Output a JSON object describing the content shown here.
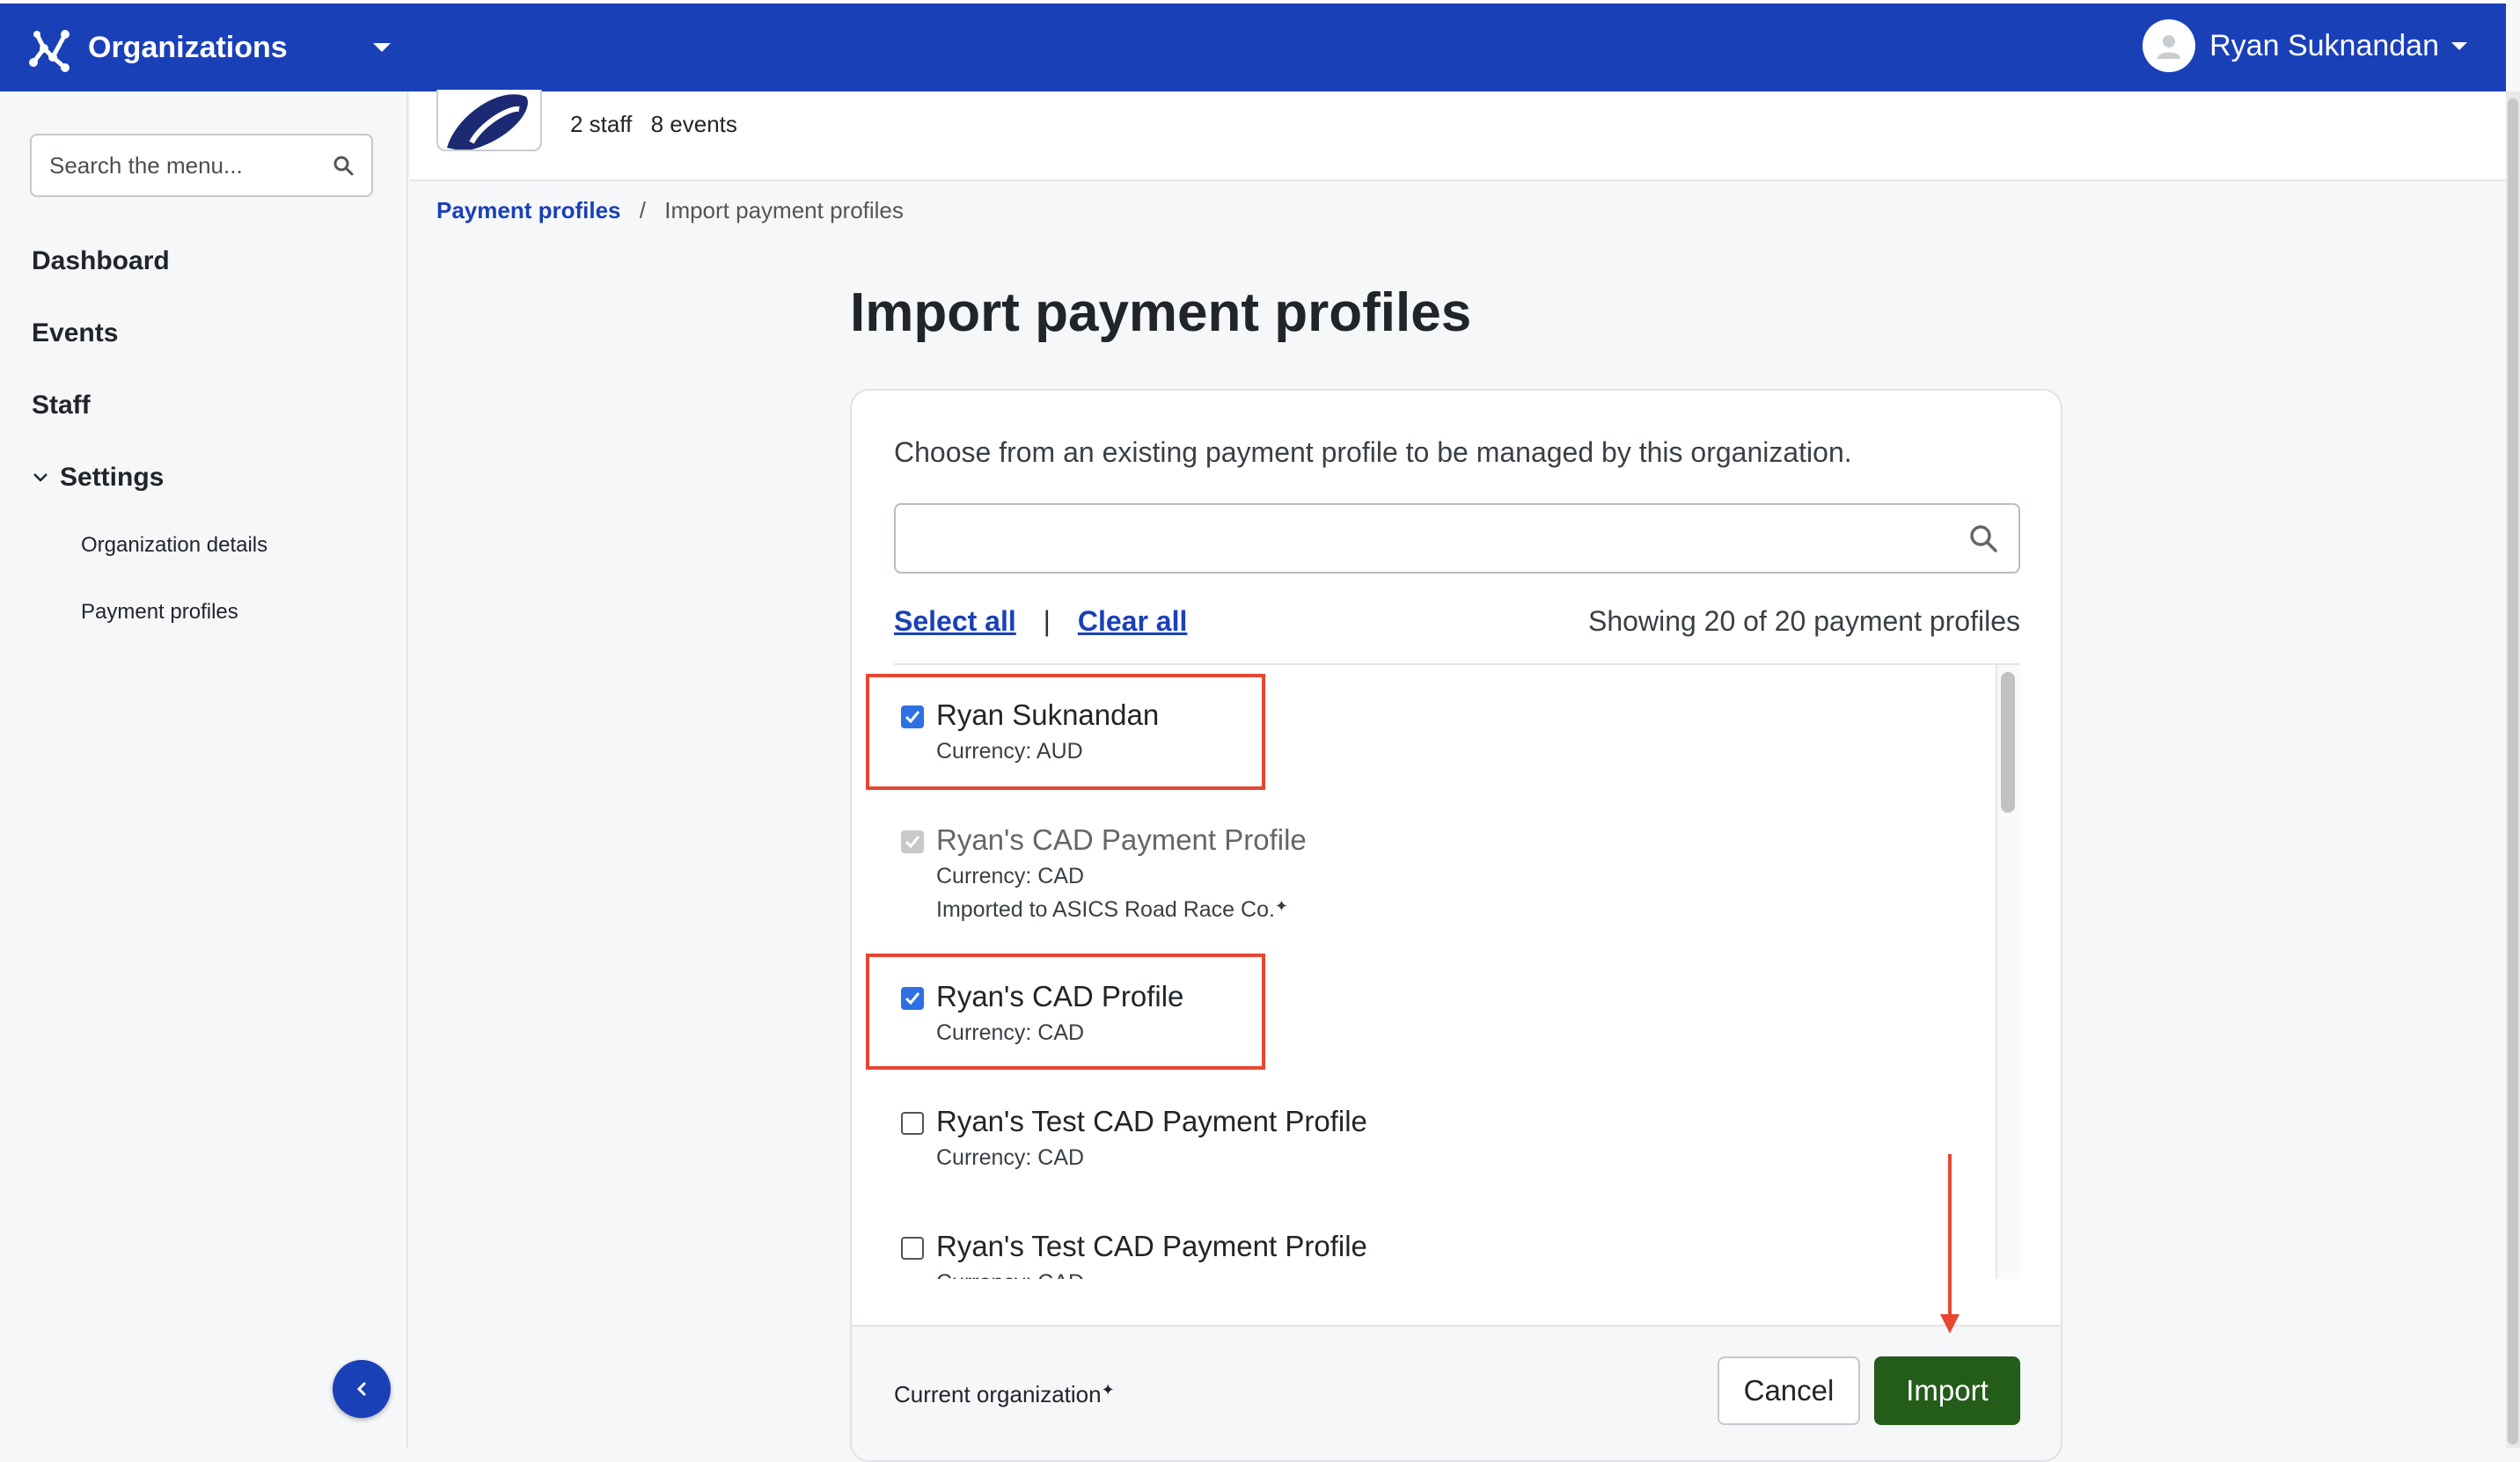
{
  "header": {
    "brand_label": "Organizations",
    "user_name": "Ryan Suknandan"
  },
  "sidebar": {
    "search_placeholder": "Search the menu...",
    "items": [
      {
        "label": "Dashboard"
      },
      {
        "label": "Events"
      },
      {
        "label": "Staff"
      },
      {
        "label": "Settings"
      }
    ],
    "sub_items": [
      {
        "label": "Organization details"
      },
      {
        "label": "Payment profiles"
      }
    ]
  },
  "org": {
    "staff": "2 staff",
    "events": "8 events"
  },
  "breadcrumb": {
    "parent": "Payment profiles",
    "separator": "/",
    "current": "Import payment profiles"
  },
  "page": {
    "title": "Import payment profiles"
  },
  "card": {
    "description": "Choose from an existing payment profile to be managed by this organization.",
    "select_all": "Select all",
    "clear_all": "Clear all",
    "showing": "Showing 20 of 20 payment profiles",
    "profiles": [
      {
        "name": "Ryan Suknandan",
        "currency": "Currency: AUD",
        "checked": true
      },
      {
        "name": "Ryan's CAD Payment Profile",
        "currency": "Currency: CAD",
        "note": "Imported to ASICS Road Race Co.",
        "checked": true,
        "disabled": true
      },
      {
        "name": "Ryan's CAD Profile",
        "currency": "Currency: CAD",
        "checked": true
      },
      {
        "name": "Ryan's Test CAD Payment Profile",
        "currency": "Currency: CAD",
        "checked": false
      },
      {
        "name": "Ryan's Test CAD Payment Profile",
        "currency": "Currency: CAD",
        "checked": false
      }
    ],
    "footer_note": "Current organization",
    "cancel_label": "Cancel",
    "import_label": "Import"
  },
  "colors": {
    "brand": "#1a40b8",
    "primary_action": "#245c1a",
    "annotation": "#e64632",
    "checkbox": "#2f6fe4"
  }
}
